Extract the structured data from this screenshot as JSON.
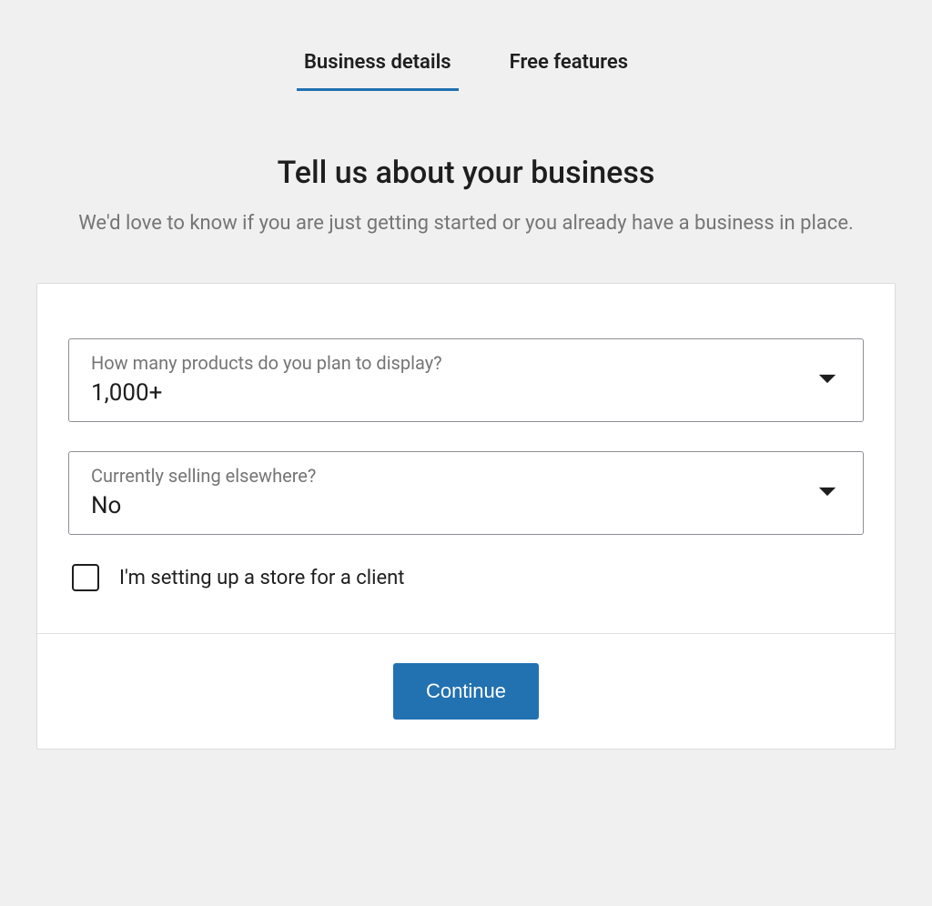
{
  "tabs": {
    "business_details": "Business details",
    "free_features": "Free features"
  },
  "header": {
    "title": "Tell us about your business",
    "subtitle": "We'd love to know if you are just getting started or you already have a business in place."
  },
  "form": {
    "product_count": {
      "label": "How many products do you plan to display?",
      "value": "1,000+"
    },
    "selling_elsewhere": {
      "label": "Currently selling elsewhere?",
      "value": "No"
    },
    "client_checkbox": {
      "label": "I'm setting up a store for a client",
      "checked": false
    }
  },
  "actions": {
    "continue": "Continue"
  }
}
